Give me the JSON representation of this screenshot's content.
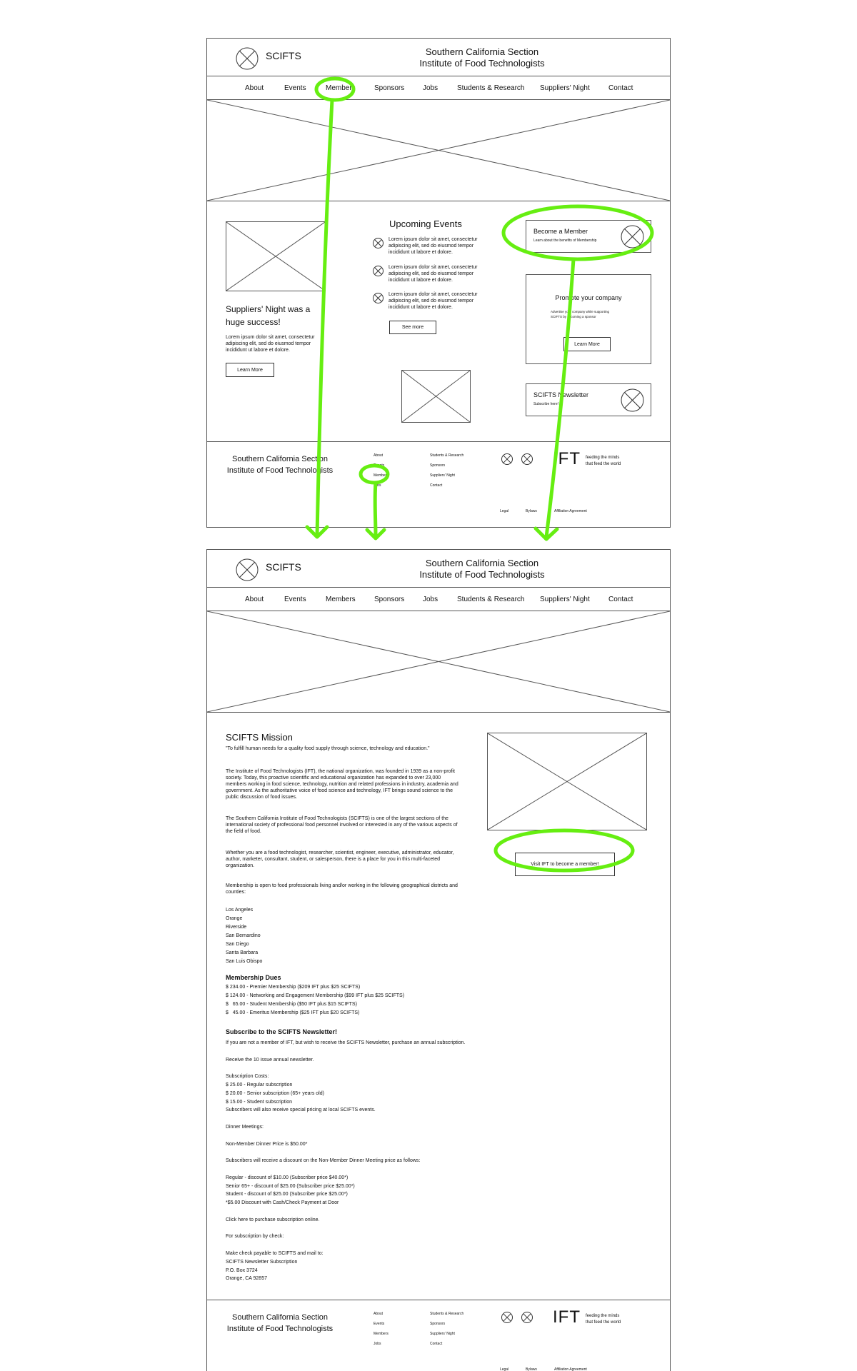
{
  "brand": {
    "logo_text": "SCIFTS",
    "title_line1": "Southern California Section",
    "title_line2": "Institute of Food Technologists"
  },
  "nav": [
    "About",
    "Events",
    "Members",
    "Sponsors",
    "Jobs",
    "Students & Research",
    "Suppliers' Night",
    "Contact"
  ],
  "home": {
    "feature_title": "Suppliers' Night was a huge success!",
    "feature_text": "Lorem ipsum dolor sit amet, consectetur adipiscing elit, sed do eiusmod tempor incididunt ut labore et dolore.",
    "feature_button": "Learn More",
    "events_title": "Upcoming Events",
    "event_text": "Lorem ipsum dolor sit amet, consectetur adipiscing elit, sed do eiusmod tempor incididunt ut labore et dolore.",
    "see_more": "See more",
    "member_title": "Become a Member",
    "member_sub": "Learn about the benefits of Membership",
    "promote_title": "Promote your company",
    "promote_text": "Advertise your company while supporting SCIFTS by becoming a sponsor",
    "promote_button": "Learn More",
    "newsletter_title": "SCIFTS Newsletter",
    "newsletter_sub": "Subscribe here!"
  },
  "footer": {
    "title_line1": "Southern California Section",
    "title_line2": "Institute of Food Technologists",
    "links_col1": [
      "About",
      "Events",
      "Members",
      "Jobs"
    ],
    "links_col2": [
      "Students & Research",
      "Sponsors",
      "Suppliers' Night",
      "Contact"
    ],
    "ift": "IFT",
    "tagline_1": "feeding the minds",
    "tagline_2": "that feed the world",
    "legal": [
      "Legal",
      "Bylaws",
      "Affiliation Agreement"
    ]
  },
  "members": {
    "mission_title": "SCIFTS Mission",
    "mission_quote": "\"To fulfill human needs for a quality food supply through science, technology and education.\"",
    "para1": "The Institute of Food Technologists (IFT), the national organization, was founded in 1939 as a non-profit society. Today, this proactive scientific and educational organization has expanded to over 23,000 members working in food science, technology, nutrition and related professions in industry, academia and government. As the authoritative voice of food science and technology, IFT brings sound science to the public discussion of food issues.",
    "para2": "The Southern California Institute of Food Technologists (SCIFTS) is one of the largest sections of the international society of professional food personnel involved or interested in any of the various aspects of the field of food.",
    "para3": "Whether you are a food technologist, researcher, scientist, engineer, executive, administrator, educator, author, marketer, consultant, student, or salesperson, there is a place for you in this multi-faceted organization.",
    "para4": "Membership is open to food professionals living and/or working in the following geographical districts and counties:",
    "counties": [
      "Los Angeles",
      "Orange",
      "Riverside",
      "San Bernardino",
      "San Diego",
      "Santa Barbara",
      "San Luis Obispo"
    ],
    "dues_title": "Membership Dues",
    "dues": [
      "$ 234.00 - Premier Membership ($209 IFT plus $25 SCIFTS)",
      "$ 124.00 - Networking and Engagement Membership ($99 IFT plus $25 SCIFTS)",
      "$   65.00 - Student Membership ($50 IFT plus $15 SCIFTS)",
      "$   45.00 - Emeritus Membership ($25 IFT plus $20 SCIFTS)"
    ],
    "subscribe_title": "Subscribe to the SCIFTS Newsletter!",
    "subscribe_lines": [
      "If you are not a member of IFT, but wish to receive the SCIFTS Newsletter, purchase an annual subscription.",
      "",
      "Receive the 10 issue annual newsletter.",
      "",
      "Subscription Costs:",
      "$ 25.00 - Regular subscription",
      "$ 20.00 - Senior subscription (65+ years old)",
      "$ 15.00 - Student subscription",
      "Subscribers will also receive special pricing at local SCIFTS events.",
      "",
      "Dinner Meetings:",
      "",
      "Non-Member Dinner Price is $50.00*",
      "",
      "Subscribers will receive a discount on the Non-Member Dinner Meeting price as follows:",
      "",
      "Regular - discount of $10.00 (Subscriber price $40.00*)",
      "Senior 65+ - discount of $25.00 (Subscriber price $25.00*)",
      "Student - discount of $25.00 (Subscriber price $25.00*)",
      "*$5.00 Discount with Cash/Check Payment at Door",
      "",
      "Click here to purchase subscription online.",
      "",
      "For subscription by check:",
      "",
      "Make check payable to SCIFTS and mail to:",
      "SCIFTS Newsletter Subscription",
      "P.O. Box 3724",
      "Orange, CA 92857"
    ],
    "visit_button": "Visit IFT to become a member!"
  },
  "colors": {
    "annotation": "#66ee11",
    "line": "#555555"
  }
}
